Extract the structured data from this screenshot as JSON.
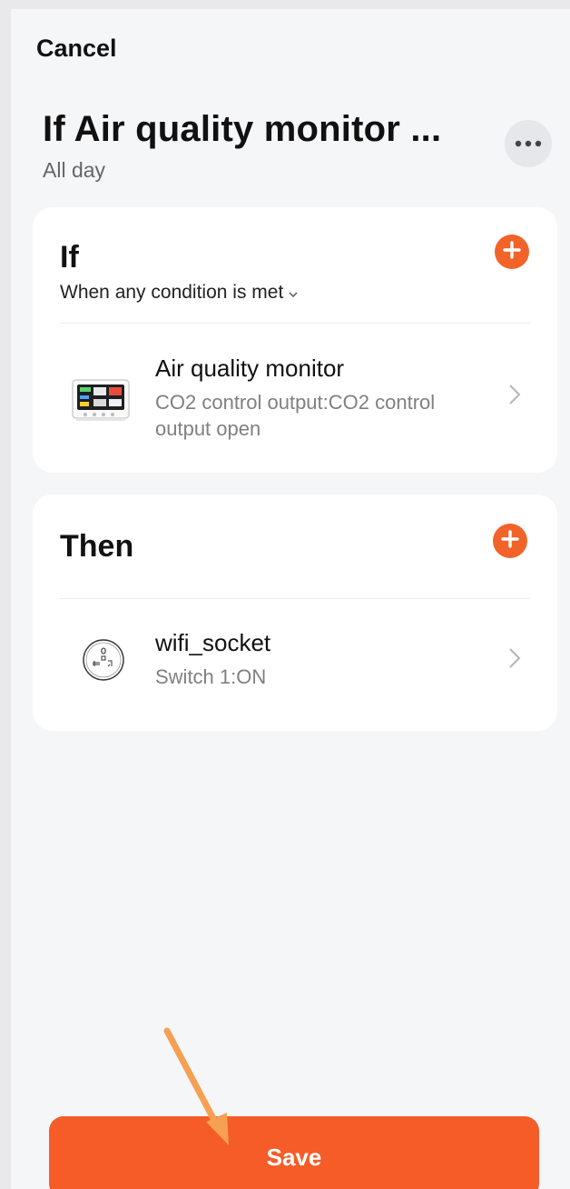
{
  "header": {
    "cancel_label": "Cancel",
    "title": "If Air quality monitor ...",
    "subtitle": "All day"
  },
  "if_section": {
    "title": "If",
    "condition_mode": "When any condition is met",
    "items": [
      {
        "name": "Air quality monitor",
        "description": "CO2 control output:CO2 control output open"
      }
    ]
  },
  "then_section": {
    "title": "Then",
    "items": [
      {
        "name": "wifi_socket",
        "description": "Switch 1:ON"
      }
    ]
  },
  "save_label": "Save",
  "colors": {
    "accent": "#f55c27",
    "add_button": "#f2632a",
    "background": "#f5f6f8"
  },
  "icons": [
    "more-icon",
    "plus-icon",
    "chevron-right-icon",
    "chevron-down-icon",
    "air-monitor-device-icon",
    "socket-device-icon"
  ]
}
